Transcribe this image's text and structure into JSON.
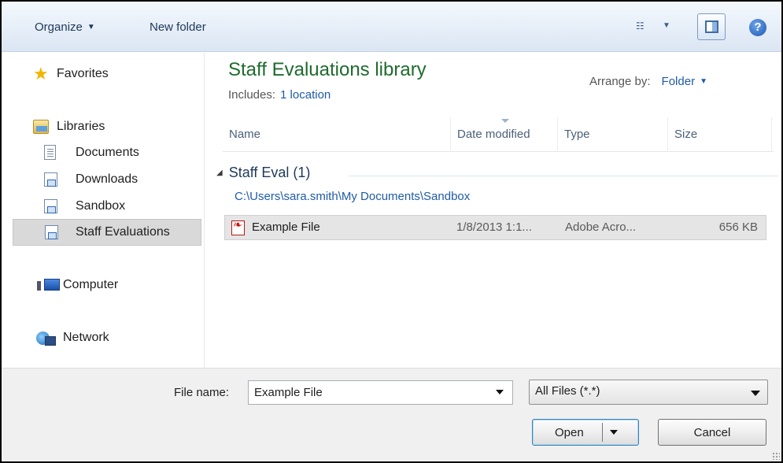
{
  "toolbar": {
    "organize_label": "Organize",
    "new_folder_label": "New folder",
    "views_icon": "view-list-icon",
    "preview_icon": "preview-pane-icon",
    "help_icon": "help-icon",
    "help_glyph": "?"
  },
  "nav": {
    "favorites": "Favorites",
    "libraries": "Libraries",
    "library_items": [
      "Documents",
      "Downloads",
      "Sandbox",
      "Staff Evaluations"
    ],
    "selected": "Staff Evaluations",
    "computer": "Computer",
    "network": "Network"
  },
  "content": {
    "title": "Staff Evaluations library",
    "includes_label": "Includes:",
    "includes_link": "1 location",
    "arrange_label": "Arrange by:",
    "arrange_value": "Folder",
    "columns": [
      "Name",
      "Date modified",
      "Type",
      "Size"
    ],
    "group": {
      "title": "Staff Eval (1)",
      "path": "C:\\Users\\sara.smith\\My Documents\\Sandbox"
    },
    "files": [
      {
        "name": "Example File",
        "date": "1/8/2013 1:1...",
        "type": "Adobe Acro...",
        "size": "656 KB",
        "icon": "pdf-file-icon"
      }
    ]
  },
  "bottom": {
    "filename_label": "File name:",
    "filename_value": "Example File",
    "filter_value": "All Files (*.*)",
    "open_label": "Open",
    "cancel_label": "Cancel"
  },
  "colors": {
    "title_green": "#1e6b2d",
    "link_blue": "#1f5ba8",
    "toolbar_text": "#1e395b"
  }
}
